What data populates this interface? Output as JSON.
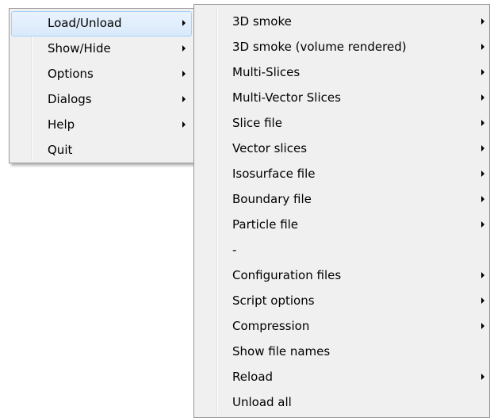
{
  "main_menu": {
    "items": [
      {
        "label": "Load/Unload",
        "submenu": true,
        "highlighted": true
      },
      {
        "label": "Show/Hide",
        "submenu": true
      },
      {
        "label": "Options",
        "submenu": true
      },
      {
        "label": "Dialogs",
        "submenu": true
      },
      {
        "label": "Help",
        "submenu": true
      },
      {
        "label": "Quit",
        "submenu": false
      }
    ]
  },
  "load_unload_submenu": {
    "items": [
      {
        "label": "3D smoke",
        "submenu": true
      },
      {
        "label": "3D smoke (volume rendered)",
        "submenu": true
      },
      {
        "label": "Multi-Slices",
        "submenu": true
      },
      {
        "label": "Multi-Vector Slices",
        "submenu": true
      },
      {
        "label": "Slice file",
        "submenu": true
      },
      {
        "label": "Vector slices",
        "submenu": true
      },
      {
        "label": "Isosurface file",
        "submenu": true
      },
      {
        "label": "Boundary file",
        "submenu": true
      },
      {
        "label": "Particle file",
        "submenu": true
      },
      {
        "label": "-",
        "submenu": false
      },
      {
        "label": "Configuration files",
        "submenu": true
      },
      {
        "label": "Script options",
        "submenu": true
      },
      {
        "label": "Compression",
        "submenu": true
      },
      {
        "label": "Show file names",
        "submenu": false
      },
      {
        "label": "Reload",
        "submenu": true
      },
      {
        "label": "Unload all",
        "submenu": false
      }
    ]
  },
  "colors": {
    "menu_background": "#f0f0f0",
    "menu_border": "#979797",
    "highlight_border": "#a8d0f7",
    "highlight_fill": "#d8e9fc"
  }
}
